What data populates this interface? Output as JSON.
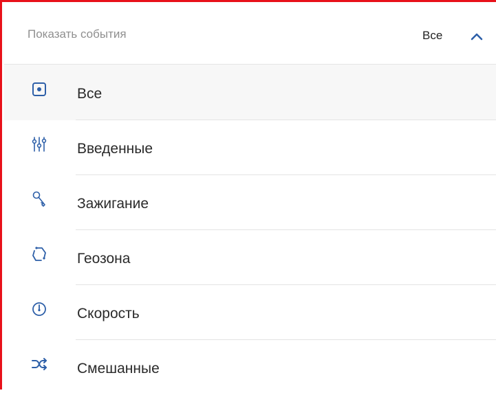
{
  "filter": {
    "label": "Показать события",
    "selected_value": "Все",
    "expanded": true,
    "accent_color": "#2d5fa8",
    "border_color": "#e8111a"
  },
  "options": [
    {
      "label": "Все",
      "icon": "radio-selected-icon",
      "selected": true
    },
    {
      "label": "Введенные",
      "icon": "sliders-icon",
      "selected": false
    },
    {
      "label": "Зажигание",
      "icon": "key-icon",
      "selected": false
    },
    {
      "label": "Геозона",
      "icon": "geozone-icon",
      "selected": false
    },
    {
      "label": "Скорость",
      "icon": "speedometer-icon",
      "selected": false
    },
    {
      "label": "Смешанные",
      "icon": "shuffle-icon",
      "selected": false
    }
  ]
}
